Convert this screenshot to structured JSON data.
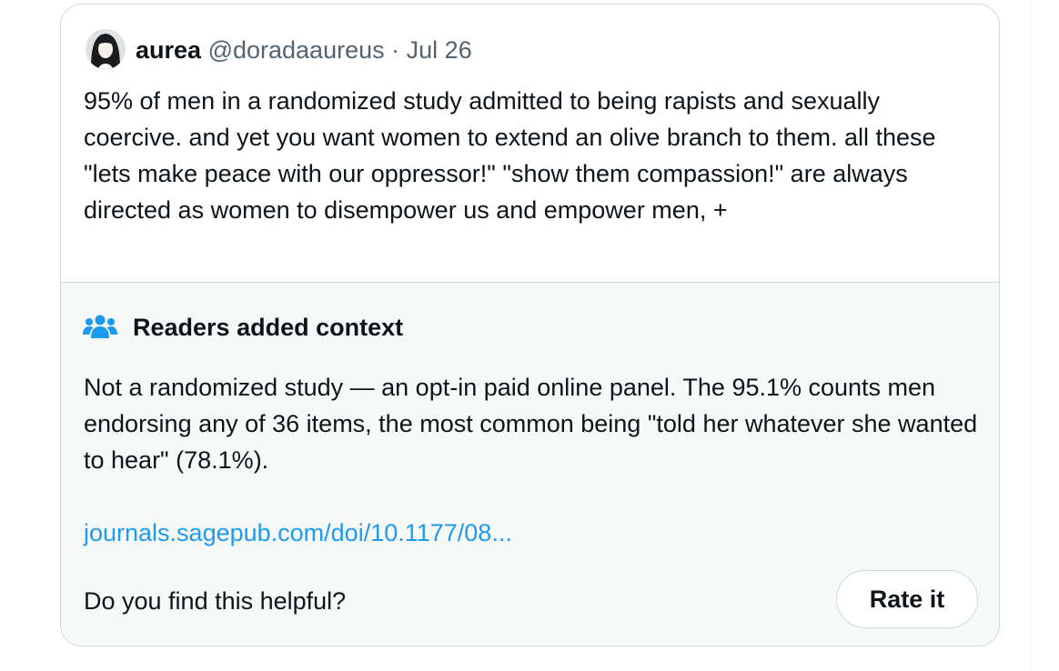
{
  "post": {
    "author_name": "aurea",
    "handle": "@doradaaureus",
    "separator": "·",
    "date": "Jul 26",
    "text": "95% of men in a randomized study admitted to being rapists and sexually coercive. and yet you want women to extend an olive branch to them. all these \"lets make peace with our oppressor!\" \"show them compassion!\" are always directed as women to disempower us and empower men, +"
  },
  "community_note": {
    "icon": "people-group-icon",
    "heading": "Readers added context",
    "body": "Not a randomized study — an opt-in paid online panel. The 95.1% counts men endorsing any of 36 items, the most common being \"told her whatever she wanted to hear\" (78.1%).",
    "link_text": "journals.sagepub.com/doi/10.1177/08...",
    "helpful_question": "Do you find this helpful?",
    "rate_button_label": "Rate it"
  },
  "colors": {
    "text_primary": "#0f1419",
    "text_secondary": "#536471",
    "link": "#1d9bf0",
    "note_background": "#f7f9f9",
    "border": "#cfd9de",
    "icon_blue": "#1d9bf0"
  }
}
